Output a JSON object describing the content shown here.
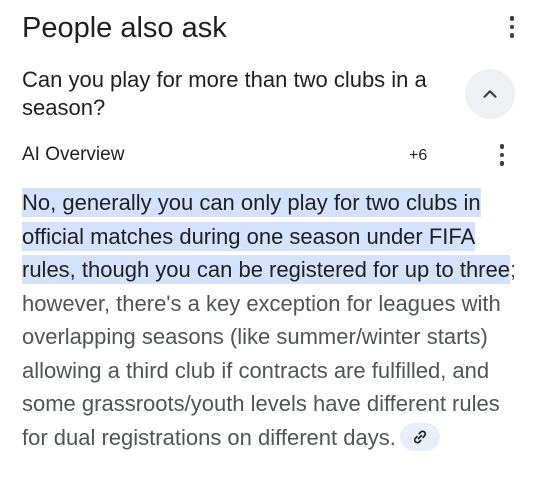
{
  "header": {
    "title": "People also ask",
    "menu_icon": "more-vert-icon"
  },
  "question": {
    "text": "Can you play for more than two clubs in a season?",
    "toggle_icon": "chevron-up-icon"
  },
  "ai_overview": {
    "label": "AI Overview",
    "count": "+6",
    "menu_icon": "more-vert-icon"
  },
  "answer": {
    "highlighted": "No, generally you can only play for two clubs in official matches during one season under FIFA rules, though you can be registered for up to three",
    "rest": "; however, there's a key exception for leagues with overlapping seasons (like summer/winter starts) allowing a third club if contracts are fulfilled, and some grassroots/youth levels have different rules for dual registrations on different days.",
    "link_icon": "link-icon"
  },
  "colors": {
    "highlight": "#d3e3fd",
    "body_text": "#505457",
    "title_text": "#1f1f1f",
    "chip_bg": "#e8effa",
    "toggle_bg": "#eef0f3"
  }
}
